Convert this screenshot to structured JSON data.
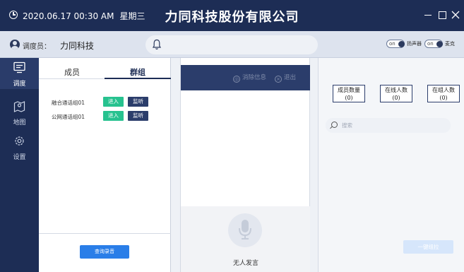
{
  "titlebar": {
    "datetime": "2020.06.17 00:30 AM",
    "weekday": "星期三",
    "app_title": "力同科技股份有限公司"
  },
  "userbar": {
    "dispatcher_label": "调度员：",
    "dispatcher_name": "力同科技",
    "toggles": [
      {
        "state": "on",
        "label": "扬声器"
      },
      {
        "state": "on",
        "label": "麦克"
      }
    ]
  },
  "nav": {
    "items": [
      {
        "label": "调度",
        "icon": "dispatch-icon",
        "active": true
      },
      {
        "label": "地图",
        "icon": "map-icon",
        "active": false
      },
      {
        "label": "设置",
        "icon": "gear-icon",
        "active": false
      }
    ]
  },
  "member_panel": {
    "tabs": [
      {
        "label": "成员",
        "active": false
      },
      {
        "label": "群组",
        "active": true
      }
    ],
    "groups": [
      {
        "name": "融合通话组01",
        "enter_label": "进入",
        "monitor_label": "监听"
      },
      {
        "name": "公网通话组01",
        "enter_label": "进入",
        "monitor_label": "监听"
      }
    ],
    "recording_button": "查询录音"
  },
  "chat_panel": {
    "dismiss_label": "消除信息",
    "quit_label": "退出",
    "no_speaker": "无人发言"
  },
  "stats_panel": {
    "stats": [
      {
        "label": "成员数量",
        "value": "(0)"
      },
      {
        "label": "在线人数",
        "value": "(0)"
      },
      {
        "label": "在组人数",
        "value": "(0)"
      }
    ],
    "search_placeholder": "搜索",
    "onekey_button": "一键组拉"
  },
  "colors": {
    "primary_navy": "#1d2d55",
    "enter_green": "#27c28f",
    "monitor_navy": "#2b3d6b",
    "accent_blue": "#2a7ee8"
  }
}
